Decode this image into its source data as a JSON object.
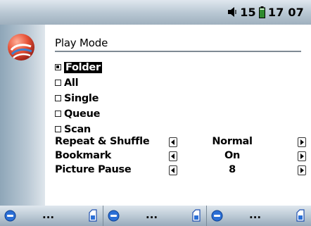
{
  "status": {
    "volume": "15",
    "time": "17 07"
  },
  "menu": {
    "title": "Play Mode",
    "options": [
      {
        "label": "Folder",
        "checked": true,
        "selected": true
      },
      {
        "label": "All",
        "checked": false,
        "selected": false
      },
      {
        "label": "Single",
        "checked": false,
        "selected": false
      },
      {
        "label": "Queue",
        "checked": false,
        "selected": false
      },
      {
        "label": "Scan",
        "checked": false,
        "selected": false
      }
    ],
    "settings": [
      {
        "name": "Repeat & Shuffle",
        "value": "Normal"
      },
      {
        "name": "Bookmark",
        "value": "On"
      },
      {
        "name": "Picture Pause",
        "value": "8"
      }
    ]
  },
  "softkeys": [
    {
      "label": "..."
    },
    {
      "label": "..."
    },
    {
      "label": "..."
    }
  ],
  "colors": {
    "accent_blue": "#2b6fd6",
    "bar_light": "#dfe7ee",
    "bar_dark": "#98aabb",
    "battery_green": "#2e8a2e"
  }
}
